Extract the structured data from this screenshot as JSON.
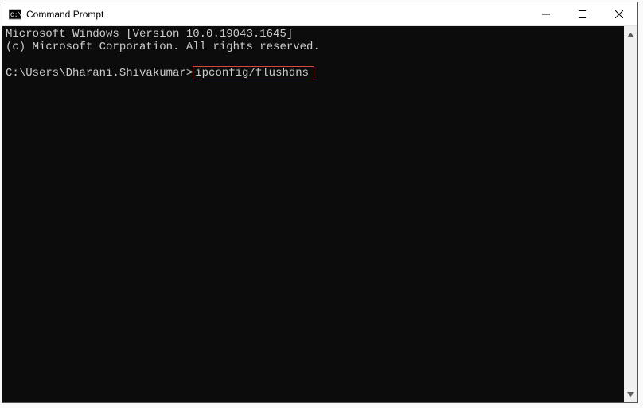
{
  "titlebar": {
    "title": "Command Prompt",
    "icon_name": "cmd-icon"
  },
  "terminal": {
    "line1": "Microsoft Windows [Version 10.0.19043.1645]",
    "line2": "(c) Microsoft Corporation. All rights reserved.",
    "prompt": "C:\\Users\\Dharani.Shivakumar>",
    "command": "ipconfig/flushdns"
  }
}
